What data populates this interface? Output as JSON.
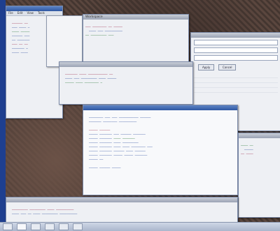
{
  "menus": {
    "main": [
      "File",
      "Edit",
      "View",
      "Tools"
    ],
    "dropdown": [
      "",
      "",
      "",
      "",
      "",
      "",
      "",
      "",
      "",
      ""
    ]
  },
  "windows": {
    "left_editor": {
      "title": ""
    },
    "top_middle": {
      "title": "Workspace"
    },
    "right_form": {
      "title": "",
      "button1": "Apply",
      "button2": "Cancel"
    },
    "mid_editor": {
      "title": ""
    },
    "front_console": {
      "title": ""
    },
    "bottom_editor": {
      "title": ""
    },
    "right_lower": {
      "title": ""
    }
  },
  "taskbar": {
    "items": [
      "",
      "",
      "",
      "",
      "",
      ""
    ]
  }
}
